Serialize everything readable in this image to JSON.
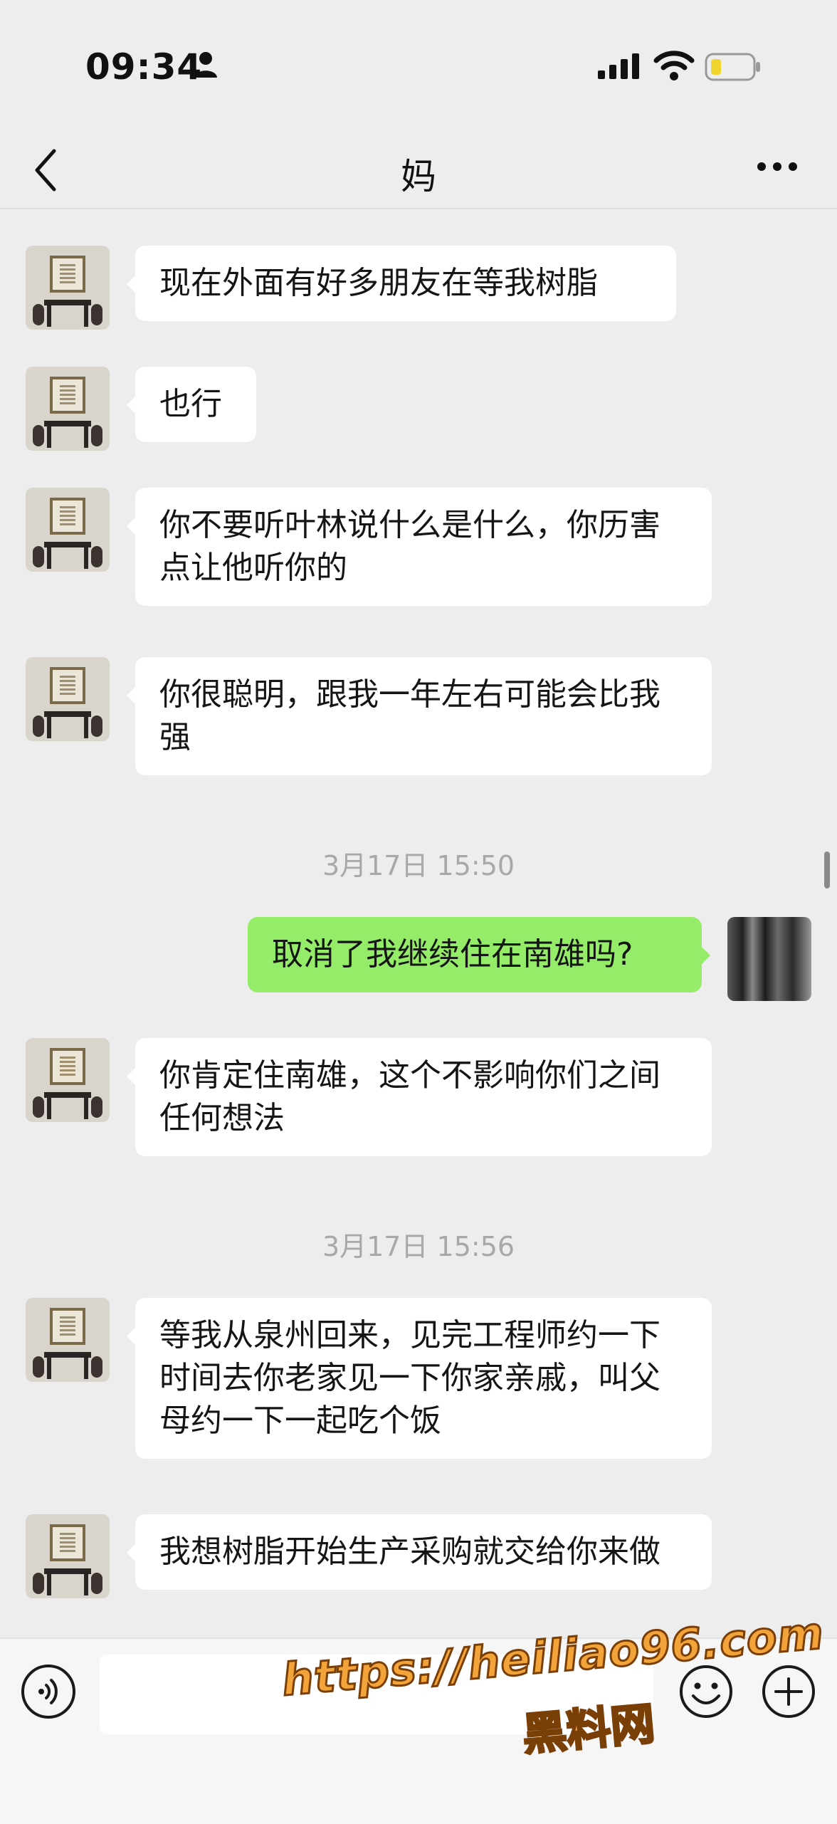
{
  "status_bar": {
    "time": "09:34"
  },
  "header": {
    "title": "妈"
  },
  "messages": [
    {
      "from": "other",
      "text": "现在外面有好多朋友在等我树脂"
    },
    {
      "from": "other",
      "text": "也行"
    },
    {
      "from": "other",
      "text": "你不要听叶林说什么是什么，你历害点让他听你的"
    },
    {
      "from": "other",
      "text": "你很聪明，跟我一年左右可能会比我强"
    },
    {
      "type": "timestamp",
      "text": "3月17日 15:50"
    },
    {
      "from": "self",
      "text": "取消了我继续住在南雄吗?"
    },
    {
      "from": "other",
      "text": "你肯定住南雄，这个不影响你们之间任何想法"
    },
    {
      "type": "timestamp",
      "text": "3月17日 15:56"
    },
    {
      "from": "other",
      "text": "等我从泉州回来，见完工程师约一下时间去你老家见一下你家亲戚，叫父母约一下一起吃个饭"
    },
    {
      "from": "other",
      "text": "我想树脂开始生产采购就交给你来做"
    }
  ],
  "input_bar": {
    "text_value": ""
  },
  "watermark": {
    "url": "https://heiliao96.com",
    "site_name": "黑料网"
  },
  "colors": {
    "self_bubble": "#95ec69",
    "other_bubble": "#ffffff",
    "background": "#ededed"
  }
}
